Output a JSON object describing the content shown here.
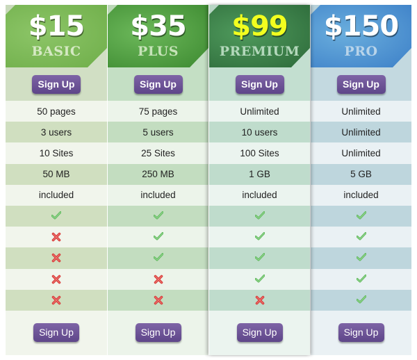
{
  "plans": [
    {
      "price": "$15",
      "name": "BASIC",
      "signup_top": "Sign Up",
      "signup_bottom": "Sign Up",
      "colors": {
        "header_start": "#8cc567",
        "header_end": "#6fae4a",
        "header_edge": "#7aa94e",
        "price_text": "#ffffff",
        "name_text": "#d5e9c3",
        "signup_bg": "#d1dfc4",
        "row_light": "#f1f5ec",
        "row_dark": "#d0dfc0",
        "footer_bg": "#f1f5ec",
        "corner": "#c9d9bb"
      },
      "features": [
        {
          "type": "text",
          "value": "50 pages"
        },
        {
          "type": "text",
          "value": "3 users"
        },
        {
          "type": "text",
          "value": "10 Sites"
        },
        {
          "type": "text",
          "value": "50 MB"
        },
        {
          "type": "text",
          "value": "included"
        },
        {
          "type": "icon",
          "value": "check"
        },
        {
          "type": "icon",
          "value": "cross"
        },
        {
          "type": "icon",
          "value": "cross"
        },
        {
          "type": "icon",
          "value": "cross"
        },
        {
          "type": "icon",
          "value": "cross"
        }
      ]
    },
    {
      "price": "$35",
      "name": "PLUS",
      "signup_top": "Sign Up",
      "signup_bottom": "Sign Up",
      "colors": {
        "header_start": "#6cb85a",
        "header_end": "#3d8a31",
        "header_edge": "#4a923b",
        "price_text": "#ffffff",
        "name_text": "#c6e3b8",
        "signup_bg": "#c4dfc4",
        "row_light": "#ecf4ea",
        "row_dark": "#c3ddc0",
        "footer_bg": "#ecf4ea",
        "corner": "#bcd8b8"
      },
      "features": [
        {
          "type": "text",
          "value": "75 pages"
        },
        {
          "type": "text",
          "value": "5 users"
        },
        {
          "type": "text",
          "value": "25 Sites"
        },
        {
          "type": "text",
          "value": "250 MB"
        },
        {
          "type": "text",
          "value": "included"
        },
        {
          "type": "icon",
          "value": "check"
        },
        {
          "type": "icon",
          "value": "check"
        },
        {
          "type": "icon",
          "value": "check"
        },
        {
          "type": "icon",
          "value": "cross"
        },
        {
          "type": "icon",
          "value": "cross"
        }
      ]
    },
    {
      "price": "$99",
      "name": "PREMIUM",
      "featured": true,
      "signup_top": "Sign Up",
      "signup_bottom": "Sign Up",
      "colors": {
        "header_start": "#4f9a5c",
        "header_end": "#2d6a3a",
        "header_edge": "#3a7a45",
        "price_text": "#f2ff1f",
        "name_text": "#b3d8bb",
        "signup_bg": "#c3dfd0",
        "row_light": "#ebf4ef",
        "row_dark": "#bfdccc",
        "footer_bg": "#ebf4ef",
        "corner": "#b8d6c5"
      },
      "features": [
        {
          "type": "text",
          "value": "Unlimited"
        },
        {
          "type": "text",
          "value": "10 users"
        },
        {
          "type": "text",
          "value": "100 Sites"
        },
        {
          "type": "text",
          "value": "1 GB"
        },
        {
          "type": "text",
          "value": "included"
        },
        {
          "type": "icon",
          "value": "check"
        },
        {
          "type": "icon",
          "value": "check"
        },
        {
          "type": "icon",
          "value": "check"
        },
        {
          "type": "icon",
          "value": "check"
        },
        {
          "type": "icon",
          "value": "cross"
        }
      ]
    },
    {
      "price": "$150",
      "name": "PRO",
      "signup_top": "Sign Up",
      "signup_bottom": "Sign Up",
      "colors": {
        "header_start": "#6aaedd",
        "header_end": "#3d80c8",
        "header_edge": "#4a8bcc",
        "price_text": "#ffffff",
        "name_text": "#b8d4ea",
        "signup_bg": "#c3d9e0",
        "row_light": "#eaf1f4",
        "row_dark": "#bed6dd",
        "footer_bg": "#eaf1f4",
        "corner": "#b9d2da"
      },
      "features": [
        {
          "type": "text",
          "value": "Unlimited"
        },
        {
          "type": "text",
          "value": "Unlimited"
        },
        {
          "type": "text",
          "value": "Unlimited"
        },
        {
          "type": "text",
          "value": "5 GB"
        },
        {
          "type": "text",
          "value": "included"
        },
        {
          "type": "icon",
          "value": "check"
        },
        {
          "type": "icon",
          "value": "check"
        },
        {
          "type": "icon",
          "value": "check"
        },
        {
          "type": "icon",
          "value": "check"
        },
        {
          "type": "icon",
          "value": "check"
        }
      ]
    }
  ],
  "icons": {
    "check": {
      "name": "check-icon",
      "color": "#5db85a"
    },
    "cross": {
      "name": "cross-icon",
      "color": "#d9403d"
    }
  },
  "button_color": "#6b519a"
}
